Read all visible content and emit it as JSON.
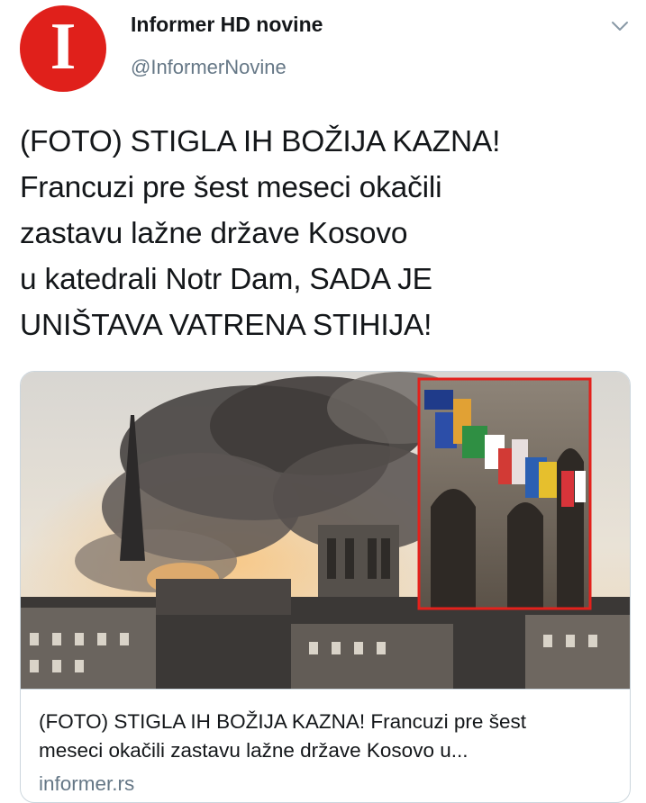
{
  "account": {
    "avatar_letter": "I",
    "name": "Informer HD novine",
    "handle": "@InformerNovine",
    "avatar_color": "#e0201b"
  },
  "tweet": {
    "lines": [
      "(FOTO) STIGLA IH BOŽIJA KAZNA!",
      "Francuzi pre šest meseci okačili",
      "zastavu lažne države Kosovo",
      "u katedrali Notr Dam, SADA JE",
      "UNIŠTAVA VATRENA STIHIJA!"
    ]
  },
  "card": {
    "title_lines": [
      "(FOTO) STIGLA IH BOŽIJA KAZNA! Francuzi pre šest",
      "meseci okačili zastavu lažne države Kosovo u..."
    ],
    "domain": "informer.rs",
    "image_description_icon": "notre-dame-fire-photo",
    "inset_border_color": "#e3211c"
  },
  "colors": {
    "text": "#14171a",
    "secondary": "#657786",
    "border": "#ccd6dd"
  }
}
